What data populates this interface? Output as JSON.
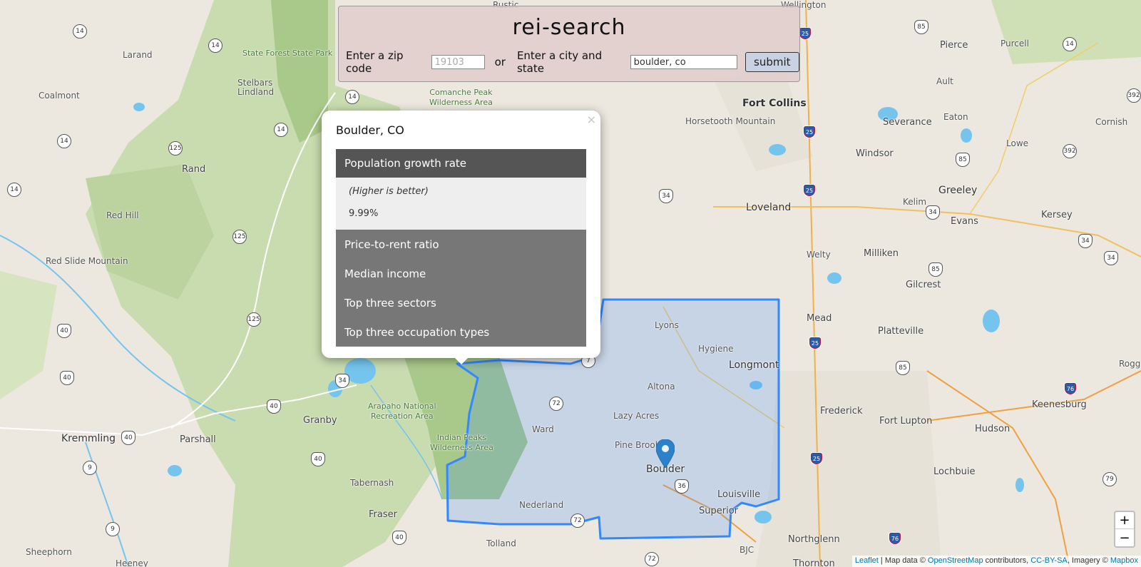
{
  "app": {
    "title": "rei-search",
    "zip_label": "Enter a zip code",
    "zip_placeholder": "19103",
    "or_label": "or",
    "city_label": "Enter a city and state",
    "city_value": "boulder, co",
    "submit_label": "submit"
  },
  "popup": {
    "close_label": "×",
    "title": "Boulder, CO",
    "sections": [
      {
        "label": "Population growth rate",
        "state": "active"
      },
      {
        "label": "Price-to-rent ratio",
        "state": "closed"
      },
      {
        "label": "Median income",
        "state": "closed"
      },
      {
        "label": "Top three sectors",
        "state": "closed"
      },
      {
        "label": "Top three occupation types",
        "state": "closed"
      }
    ],
    "active_note": "(Higher is better)",
    "active_value": "9.99%"
  },
  "map": {
    "places": {
      "rustic": "Rustic",
      "wellington": "Wellington",
      "pierce": "Pierce",
      "purcell": "Purcell",
      "larand": "Larand",
      "state_forest": "State Forest State Park",
      "stelbars": "Stelbars\nLindland",
      "coalmont": "Coalmont",
      "comanche": "Comanche Peak\nWilderness Area",
      "fort_collins": "Fort Collins",
      "ault": "Ault",
      "eaton": "Eaton",
      "horsetooth": "Horsetooth Mountain",
      "severance": "Severance",
      "cornish": "Cornish",
      "lowe": "Lowe",
      "windsor": "Windsor",
      "rand": "Rand",
      "greeley": "Greeley",
      "kelim": "Kelim",
      "loveland": "Loveland",
      "evans": "Evans",
      "kersey": "Kersey",
      "red_hill": "Red Hill",
      "welty": "Welty",
      "milliken": "Milliken",
      "red_slide": "Red Slide Mountain",
      "gilcrest": "Gilcrest",
      "mead": "Mead",
      "platteville": "Platteville",
      "lyons": "Lyons",
      "hygiene": "Hygiene",
      "longmont": "Longmont",
      "rogge": "Rogge",
      "keenesburg": "Keenesburg",
      "altona": "Altona",
      "arapaho": "Arapaho National\nRecreation Area",
      "granby": "Granby",
      "lazy_acres": "Lazy Acres",
      "frederick": "Frederick",
      "fort_lupton": "Fort Lupton",
      "hudson": "Hudson",
      "kremmling": "Kremmling",
      "parshall": "Parshall",
      "ward": "Ward",
      "indian_peaks": "Indian Peaks\nWilderness Area",
      "pine_brook": "Pine Brook",
      "boulder": "Boulder",
      "tabernash": "Tabernash",
      "lochbuie": "Lochbuie",
      "louisville": "Louisville",
      "nederland": "Nederland",
      "fraser": "Fraser",
      "superior": "Superior",
      "northglenn": "Northglenn",
      "sheephorn": "Sheephorn",
      "tolland": "Tolland",
      "bjc": "BJC",
      "heeney": "Heeney",
      "thornton": "Thornton"
    }
  },
  "attribution": {
    "leaflet": "Leaflet",
    "map_data": " | Map data © ",
    "osm": "OpenStreetMap",
    "contributors": " contributors, ",
    "license": "CC-BY-SA",
    "imagery": ", Imagery © ",
    "mapbox": "Mapbox"
  },
  "zoom": {
    "in_label": "+",
    "out_label": "−"
  },
  "colors": {
    "map_background": "#ece8df",
    "forest": "#c9dcb0",
    "water": "#75c4ee",
    "boundary": "#3388ff",
    "popup_active_header": "#555555",
    "popup_closed_header": "#777777",
    "submit_button": "#c8d2e2"
  }
}
